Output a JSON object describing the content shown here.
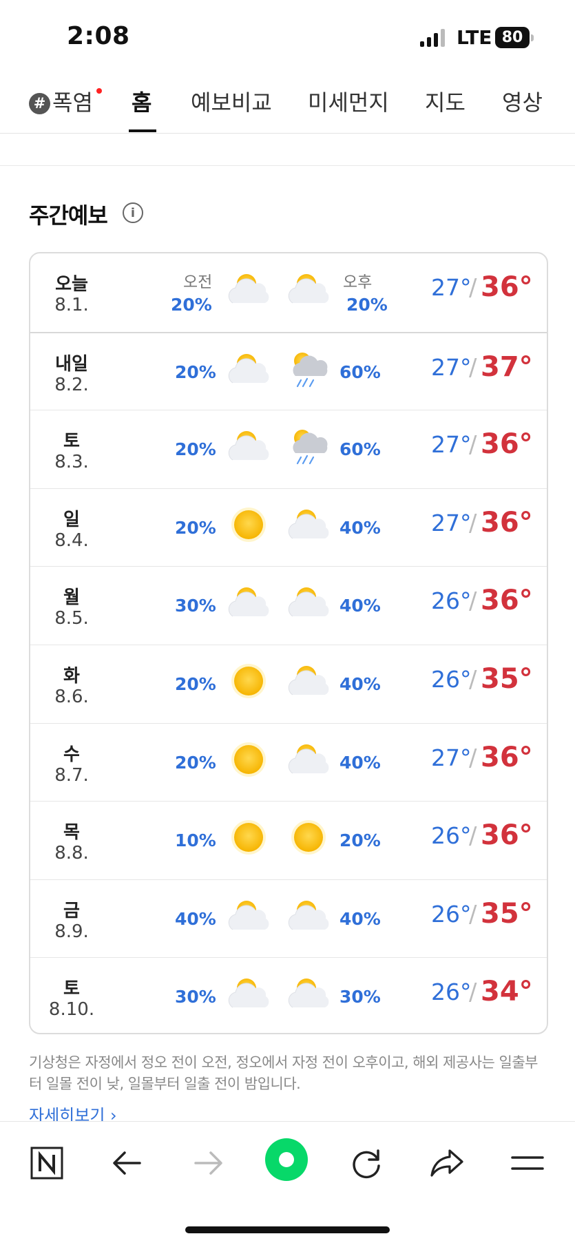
{
  "status_bar": {
    "time": "2:08",
    "network": "LTE",
    "battery": "80"
  },
  "tabs": [
    {
      "label": "폭염",
      "badge": "#",
      "new_dot": true
    },
    {
      "label": "홈",
      "active": true
    },
    {
      "label": "예보비교"
    },
    {
      "label": "미세먼지"
    },
    {
      "label": "지도"
    },
    {
      "label": "영상"
    }
  ],
  "section": {
    "title": "주간예보",
    "info_icon": "info-icon"
  },
  "forecast": {
    "am_label": "오전",
    "pm_label": "오후",
    "rows": [
      {
        "day": "오늘",
        "date": "8.1.",
        "am_pct": "20%",
        "am_icon": "partly-cloudy",
        "pm_pct": "20%",
        "pm_icon": "partly-cloudy",
        "low": "27°",
        "high": "36°"
      },
      {
        "day": "내일",
        "date": "8.2.",
        "am_pct": "20%",
        "am_icon": "partly-cloudy",
        "pm_pct": "60%",
        "pm_icon": "rain",
        "low": "27°",
        "high": "37°"
      },
      {
        "day": "토",
        "date": "8.3.",
        "am_pct": "20%",
        "am_icon": "partly-cloudy",
        "pm_pct": "60%",
        "pm_icon": "rain",
        "low": "27°",
        "high": "36°"
      },
      {
        "day": "일",
        "date": "8.4.",
        "am_pct": "20%",
        "am_icon": "sunny",
        "pm_pct": "40%",
        "pm_icon": "partly-cloudy",
        "low": "27°",
        "high": "36°"
      },
      {
        "day": "월",
        "date": "8.5.",
        "am_pct": "30%",
        "am_icon": "partly-cloudy",
        "pm_pct": "40%",
        "pm_icon": "partly-cloudy",
        "low": "26°",
        "high": "36°"
      },
      {
        "day": "화",
        "date": "8.6.",
        "am_pct": "20%",
        "am_icon": "sunny",
        "pm_pct": "40%",
        "pm_icon": "partly-cloudy",
        "low": "26°",
        "high": "35°"
      },
      {
        "day": "수",
        "date": "8.7.",
        "am_pct": "20%",
        "am_icon": "sunny",
        "pm_pct": "40%",
        "pm_icon": "partly-cloudy",
        "low": "27°",
        "high": "36°"
      },
      {
        "day": "목",
        "date": "8.8.",
        "am_pct": "10%",
        "am_icon": "sunny",
        "pm_pct": "20%",
        "pm_icon": "sunny",
        "low": "26°",
        "high": "36°"
      },
      {
        "day": "금",
        "date": "8.9.",
        "am_pct": "40%",
        "am_icon": "partly-cloudy",
        "pm_pct": "40%",
        "pm_icon": "partly-cloudy",
        "low": "26°",
        "high": "35°"
      },
      {
        "day": "토",
        "date": "8.10.",
        "am_pct": "30%",
        "am_icon": "partly-cloudy",
        "pm_pct": "30%",
        "pm_icon": "partly-cloudy",
        "low": "26°",
        "high": "34°"
      }
    ]
  },
  "note": "기상청은 자정에서 정오 전이 오전, 정오에서 자정 전이 오후이고, 해외 제공사는 일출부터 일몰 전이 낮, 일몰부터 일출 전이 밤입니다.",
  "more_link": "자세히보기",
  "toolbar": [
    "naver-home-icon",
    "back-arrow-icon",
    "forward-arrow-icon",
    "green-dot-icon",
    "reload-icon",
    "share-icon",
    "menu-icon"
  ],
  "colors": {
    "precip": "#2f6fd8",
    "low": "#2f6fd8",
    "high": "#d2323c",
    "green": "#07d869"
  }
}
